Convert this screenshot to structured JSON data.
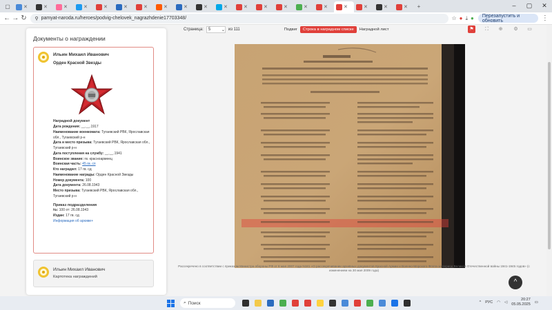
{
  "browser": {
    "tabs": [
      {
        "label": "",
        "color": "#4a8ad8"
      },
      {
        "label": "",
        "color": "#333333"
      },
      {
        "label": "",
        "color": "#ff6c9a"
      },
      {
        "label": "",
        "color": "#1d9bf0"
      },
      {
        "label": "",
        "color": "#e0403a"
      },
      {
        "label": "",
        "color": "#2a6bbf"
      },
      {
        "label": "",
        "color": "#e0403a"
      },
      {
        "label": "",
        "color": "#ff5a00"
      },
      {
        "label": "",
        "color": "#2a6bbf"
      },
      {
        "label": "",
        "color": "#333333"
      },
      {
        "label": "",
        "color": "#00a8e8"
      },
      {
        "label": "",
        "color": "#e0403a"
      },
      {
        "label": "",
        "color": "#e0403a"
      },
      {
        "label": "",
        "color": "#e0403a"
      },
      {
        "label": "",
        "color": "#4caf50"
      },
      {
        "label": "",
        "color": "#e0403a"
      },
      {
        "label": "",
        "color": "#e0403a"
      },
      {
        "label": "",
        "color": "#e0403a"
      },
      {
        "label": "",
        "color": "#333333"
      },
      {
        "label": "",
        "color": "#e0403a"
      }
    ],
    "active_tab_index": 16,
    "url": "pamyat-naroda.ru/heroes/podvig-chelovek_nagrazhdenie17703348/",
    "relaunch_label": "Перезапустить и обновить"
  },
  "left_panel": {
    "title": "Документы о награждении",
    "card1": {
      "name": "Ильин Михаил Иванович",
      "order": "Орден Красной Звезды",
      "section_title": "Наградной документ",
      "fields": [
        {
          "label": "Дата рождения:",
          "value": "__.__.1917"
        },
        {
          "label": "Наименование военкомата:",
          "value": "Тугаевский РВК, Ярославская обл., Тугаевский р-н"
        },
        {
          "label": "Дата и место призыва:",
          "value": "Тугаевский РВК, Ярославская обл., Тугаевский р-н"
        },
        {
          "label": "Дата поступления на службу:",
          "value": "__.__.1941"
        },
        {
          "label": "Воинское звание:",
          "value": "гв. красноармеец"
        },
        {
          "label": "Воинская часть:",
          "value": "45 гв. сп",
          "link": true
        },
        {
          "label": "Кто наградил:",
          "value": "17 гв. сд"
        },
        {
          "label": "Наименование награды:",
          "value": "Орден Красной Звезды"
        },
        {
          "label": "Номер документа:",
          "value": "100"
        },
        {
          "label": "Дата документа:",
          "value": "26.08.1943"
        },
        {
          "label": "Место призыва:",
          "value": "Тугаевский РВК, Ярославская обл., Тугаевский р-н"
        }
      ],
      "sub_title": "Приказ подразделения",
      "sub_fields": [
        {
          "label": "№:",
          "value": "100 от: 26.08.1943"
        },
        {
          "label": "Издан:",
          "value": "17 гв. сд"
        }
      ],
      "archive_link": "Информация об архиве+"
    },
    "card2": {
      "name": "Ильин Михаил Иванович",
      "subtitle": "Картотека награждений"
    }
  },
  "viewer": {
    "page_label": "Страница:",
    "page_value": "5",
    "page_total": "из 111",
    "tabs": [
      "Подвиг",
      "Строка в наградном списке",
      "Наградной лист"
    ],
    "active_tab_index": 1,
    "caption": "Рассекречено в соответствии с приказом Министра обороны РФ от 8 мая 2007 года N181 «О рассекречивании архивных документов Красной Армии и Военно-Морского Флота за период Великой Отечественной войны 1941-1945 годов» (с изменением на 30 мая 2009 года)"
  },
  "taskbar": {
    "search_placeholder": "Поиск",
    "lang": "РУС",
    "time": "20:27",
    "date": "05.05.2025"
  }
}
